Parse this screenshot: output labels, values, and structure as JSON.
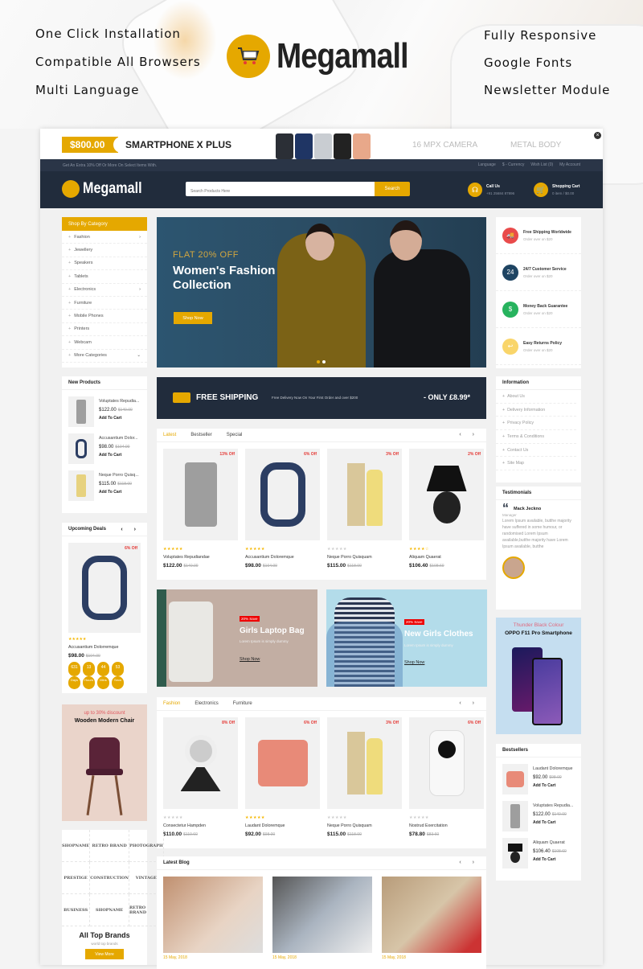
{
  "showcase": {
    "brand_name": "Megamall",
    "features_left": [
      "One Click Installation",
      "Compatible All Browsers",
      "Multi Language"
    ],
    "features_right": [
      "Fully Responsive",
      "Google Fonts",
      "Newsletter Module"
    ]
  },
  "promo_bar": {
    "price": "$800.00",
    "product": "SMARTPHONE  X PLUS",
    "feature_1": "16 MPX CAMERA",
    "feature_2": "METAL BODY",
    "close_icon": "close-icon"
  },
  "top_bar": {
    "message": "Get An Extra 10% Off Or More On Select Items With.",
    "language": "Language",
    "currency": "$ - Currency",
    "wishlist": "Wish List (0)",
    "account": "My Account"
  },
  "header": {
    "logo": "Megamall",
    "search_placeholder": "Search Products Here",
    "search_button": "Search",
    "call_title": "Call Us",
    "call_number": "+91 25684 87896",
    "cart_title": "Shopping Cart",
    "cart_summary": "0 item / $0.00"
  },
  "categories": {
    "title": "Shop By Category",
    "items": [
      {
        "label": "Fashion",
        "has_sub": true
      },
      {
        "label": "Jewellery",
        "has_sub": false
      },
      {
        "label": "Speakers",
        "has_sub": false
      },
      {
        "label": "Tablets",
        "has_sub": false
      },
      {
        "label": "Electronics",
        "has_sub": true
      },
      {
        "label": "Furniture",
        "has_sub": false
      },
      {
        "label": "Mobile Phones",
        "has_sub": false
      },
      {
        "label": "Printers",
        "has_sub": false
      },
      {
        "label": "Webcam",
        "has_sub": false
      },
      {
        "label": "More Categories",
        "has_sub": true
      }
    ]
  },
  "hero": {
    "subtitle": "FLAT 20% OFF",
    "title": "Women's Fashion Collection",
    "button": "Shop Now",
    "slides": 2,
    "active_slide": 1
  },
  "services": [
    {
      "title": "Free Shipping Worldwide",
      "sub": "Order over on $20",
      "color": "#e94b4b"
    },
    {
      "title": "24/7 Customer Service",
      "sub": "Order over on $20",
      "color": "#1e4462"
    },
    {
      "title": "Money Back Guarantee",
      "sub": "Order over on $20",
      "color": "#27b35e"
    },
    {
      "title": "Easy Returns Policy",
      "sub": "Order over on $20",
      "color": "#f9d56a"
    }
  ],
  "new_products": {
    "title": "New Products",
    "add_to_cart": "Add To Cart",
    "items": [
      {
        "name": "Voluptates Repudia...",
        "price": "$122.00",
        "old": "$140.00"
      },
      {
        "name": "Accusantium Dolor...",
        "price": "$98.00",
        "old": "$104.00"
      },
      {
        "name": "Neque Porro Quisq...",
        "price": "$115.00",
        "old": "$118.00"
      }
    ]
  },
  "shipping_banner": {
    "title": "FREE SHIPPING",
    "text": "Free Delivery Now On Your First Order and over $200",
    "price": "- ONLY £8.99*"
  },
  "tabs1": {
    "tabs": [
      "Latest",
      "Bestseller",
      "Special"
    ],
    "active": 0,
    "products": [
      {
        "name": "Voluptates Repudiandae",
        "price": "$122.00",
        "old": "$140.00",
        "off": "13% Off",
        "rating": 5
      },
      {
        "name": "Accusantium Doloremque",
        "price": "$98.00",
        "old": "$104.00",
        "off": "6% Off",
        "rating": 5
      },
      {
        "name": "Neque Porro Quisquam",
        "price": "$115.00",
        "old": "$118.00",
        "off": "3% Off",
        "rating": 0
      },
      {
        "name": "Aliquam Quaerat",
        "price": "$106.40",
        "old": "$108.60",
        "off": "2% Off",
        "rating": 4
      }
    ]
  },
  "information": {
    "title": "Information",
    "items": [
      "About Us",
      "Delivery Information",
      "Privacy Policy",
      "Terms & Conditions",
      "Contact Us",
      "Site Map"
    ]
  },
  "testimonials": {
    "title": "Testimonials",
    "name": "Mack Jeckno",
    "role": "Manager",
    "text": "Lorem Ipsum available, butthe majority have suffered in some humour, or randomised Lorem Ipsum available,butthe majority have Lorem Ipsum available, butthe"
  },
  "upcoming_deals": {
    "title": "Upcoming Deals",
    "off": "6% Off",
    "name": "Accusantium Dolorremque",
    "price": "$98.00",
    "old": "$104.00",
    "rating": 5,
    "timer": [
      {
        "value": "631",
        "unit": "Days"
      },
      {
        "value": "13",
        "unit": "Hours"
      },
      {
        "value": "44",
        "unit": "Mins"
      },
      {
        "value": "53",
        "unit": "Secs"
      }
    ]
  },
  "mid_banners": [
    {
      "badge": "20% Save",
      "title": "Girls Laptop Bag",
      "sub": "Lorem Ipsum is simply dummy",
      "link": "Shop Now"
    },
    {
      "badge": "20% Save",
      "title": "New Girls Clothes",
      "sub": "Lorem Ipsum is simply dummy",
      "link": "Shop Now"
    }
  ],
  "oppo_banner": {
    "subtitle": "Thunder Black Colour",
    "title": "OPPO F11 Pro Smartphone"
  },
  "chair_banner": {
    "subtitle": "up to 30% discount",
    "title": "Wooden Modern Chair"
  },
  "tabs2": {
    "tabs": [
      "Fashion",
      "Electronics",
      "Furniture"
    ],
    "active": 0,
    "products": [
      {
        "name": "Consectetur Hampden",
        "price": "$110.00",
        "old": "$119.60",
        "off": "8% Off",
        "rating": 0
      },
      {
        "name": "Laudant Doloremque",
        "price": "$92.00",
        "old": "$98.00",
        "off": "6% Off",
        "rating": 5
      },
      {
        "name": "Neque Porro Quisquam",
        "price": "$115.00",
        "old": "$118.00",
        "off": "3% Off",
        "rating": 0
      },
      {
        "name": "Nostrud Exercitation",
        "price": "$78.80",
        "old": "$83.60",
        "off": "6% Off",
        "rating": 0
      }
    ]
  },
  "bestsellers": {
    "title": "Bestsellers",
    "add_to_cart": "Add To Cart",
    "items": [
      {
        "name": "Laudant Doloremque",
        "price": "$92.00",
        "old": "$98.00"
      },
      {
        "name": "Voluptates Repudia...",
        "price": "$122.00",
        "old": "$140.00"
      },
      {
        "name": "Aliquam Quaerat",
        "price": "$106.40",
        "old": "$108.60"
      }
    ]
  },
  "brands": {
    "logos": [
      "SHOPNAME",
      "RETRO BRAND",
      "PHOTOGRAPH",
      "PRESTIGE",
      "CONSTRUCTION",
      "VINTAGE",
      "BUSINESS",
      "SHOPNAME",
      "RETRO BRAND"
    ],
    "title": "All Top Brands",
    "sub": "world top brands",
    "button": "View More"
  },
  "blog": {
    "title": "Latest Blog",
    "posts": [
      {
        "date": "15 May, 2018"
      },
      {
        "date": "15 May, 2018"
      },
      {
        "date": "15 May, 2018"
      }
    ]
  }
}
